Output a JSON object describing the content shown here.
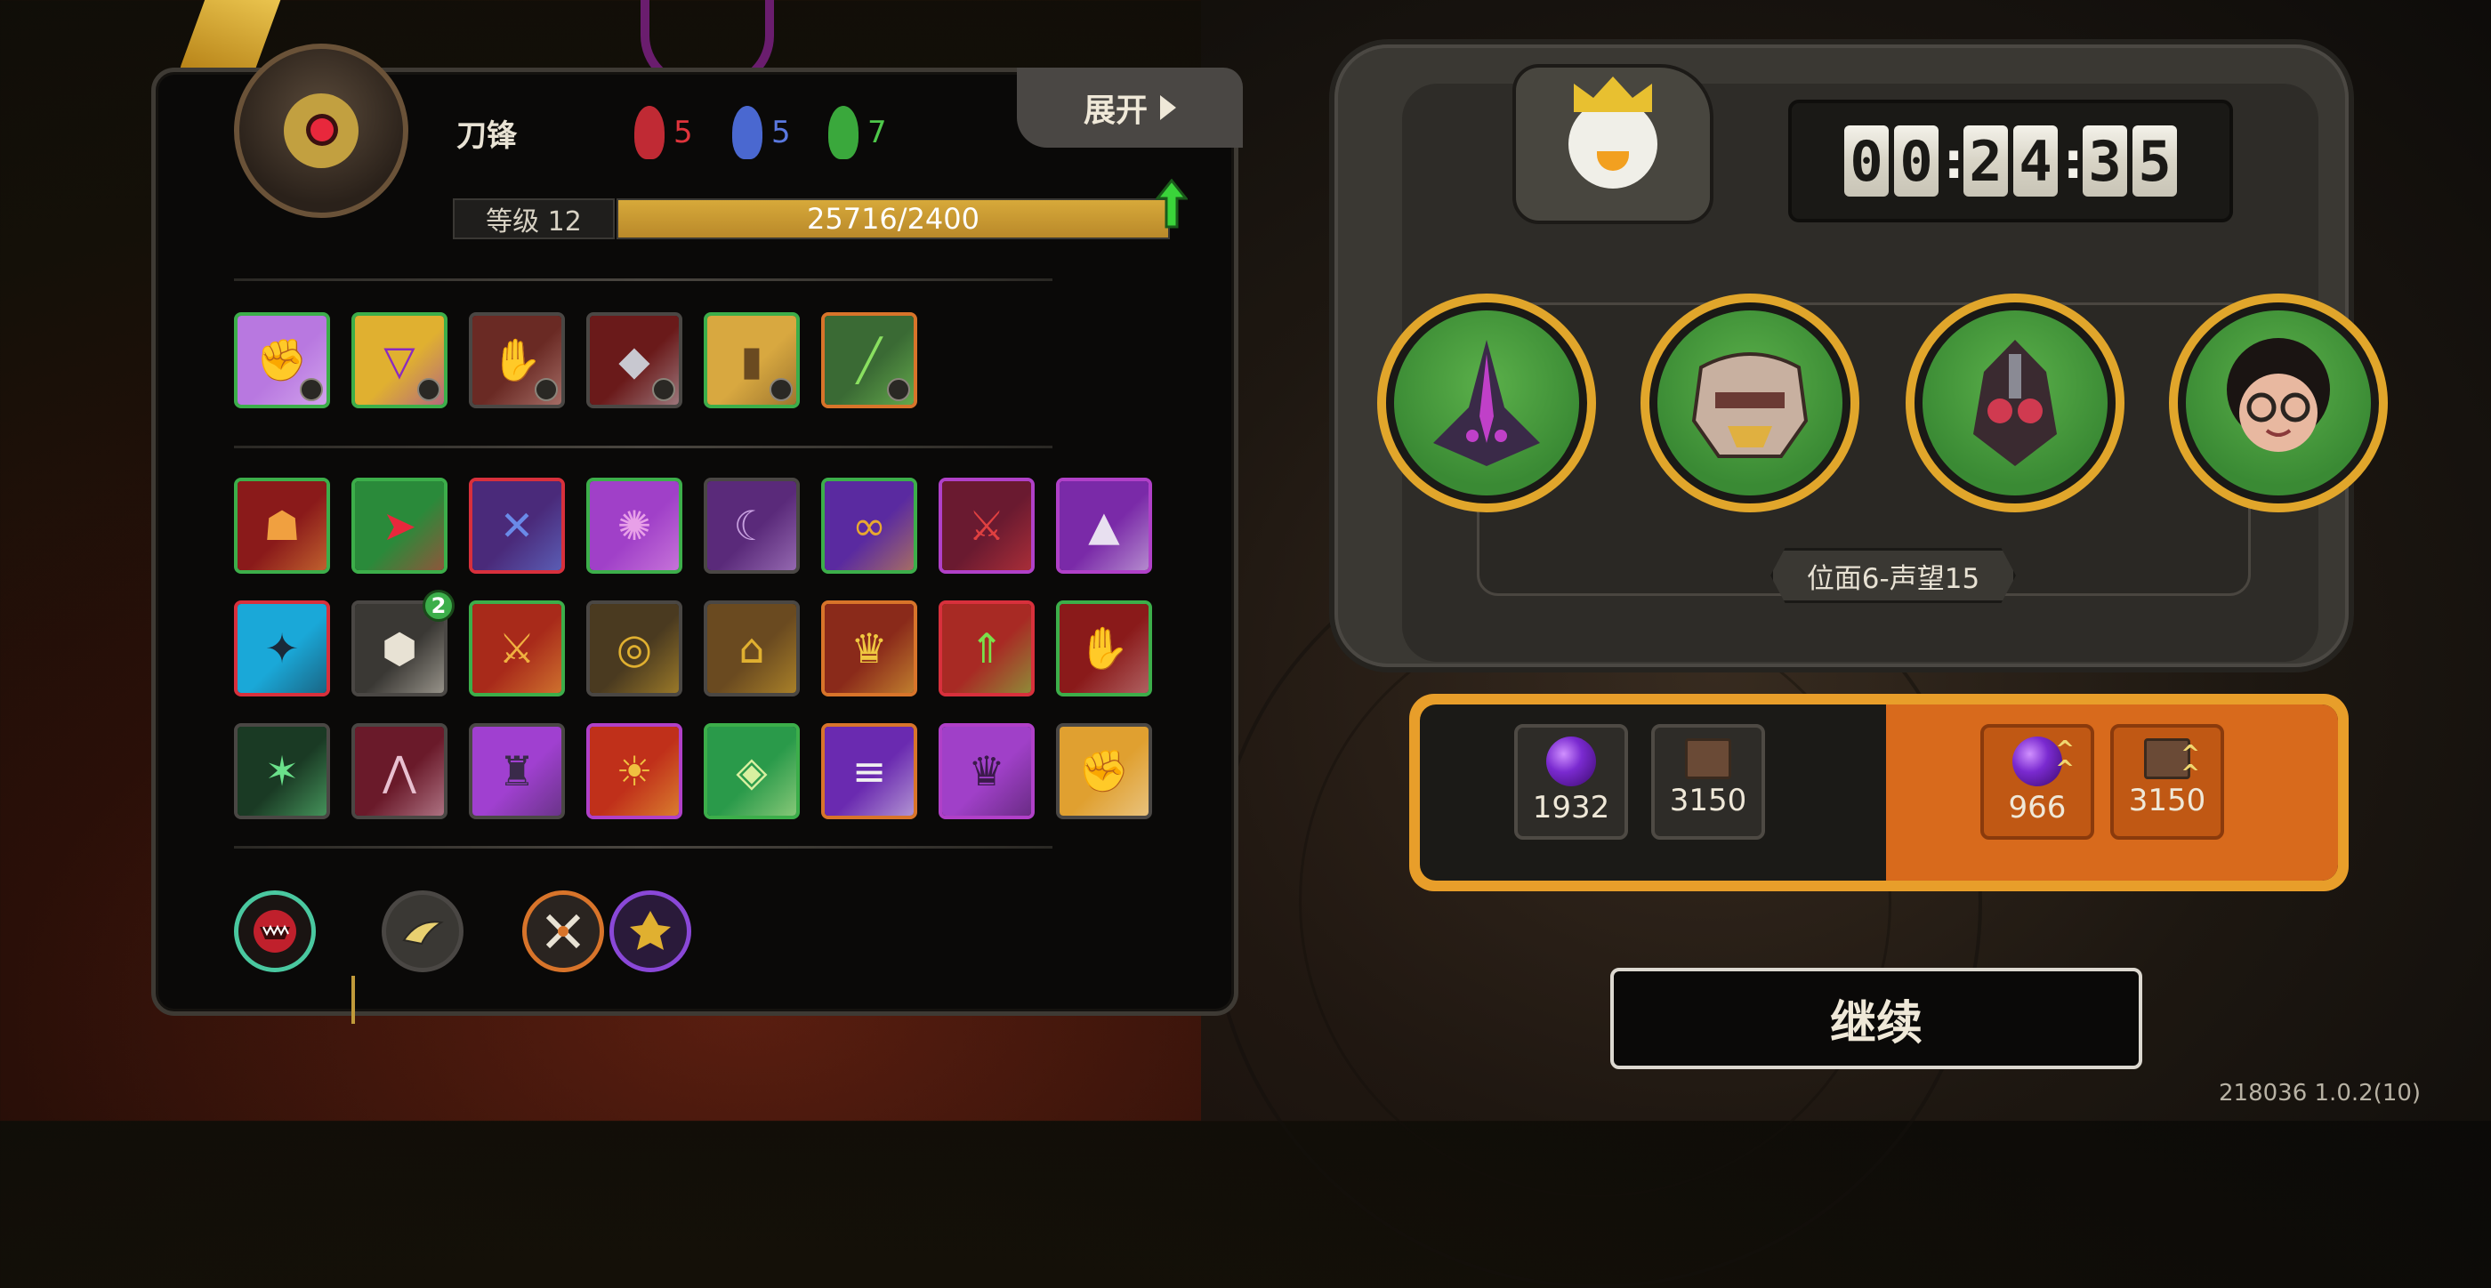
{
  "hero": {
    "name": "刀锋",
    "factions": [
      {
        "icon": "red-faction-icon",
        "count": "5",
        "color": "#e0343c"
      },
      {
        "icon": "blue-faction-icon",
        "count": "5",
        "color": "#5a78e0"
      },
      {
        "icon": "green-faction-icon",
        "count": "7",
        "color": "#4ec84a"
      }
    ],
    "level_label": "等级 12",
    "xp_text": "25716/2400",
    "xp_fill_fraction": 1.0,
    "expand_label": "展开"
  },
  "equipment_row": [
    {
      "icon": "purple-fist-icon",
      "border": "green"
    },
    {
      "icon": "gold-chest-icon",
      "border": "green"
    },
    {
      "icon": "claw-grip-icon",
      "border": "gray"
    },
    {
      "icon": "horned-helm-icon",
      "border": "gray"
    },
    {
      "icon": "gold-armor-icon",
      "border": "green"
    },
    {
      "icon": "green-syringe-icon",
      "border": "orange"
    }
  ],
  "skill_rows": [
    [
      {
        "icon": "red-beast-icon",
        "border": "green"
      },
      {
        "icon": "red-arrow-icon",
        "border": "green"
      },
      {
        "icon": "blue-mask-icon",
        "border": "red"
      },
      {
        "icon": "pink-blob-icon",
        "border": "green"
      },
      {
        "icon": "purple-claw-icon",
        "border": "gray"
      },
      {
        "icon": "purple-rune-icon",
        "border": "green"
      },
      {
        "icon": "red-blade-icon",
        "border": "purple"
      },
      {
        "icon": "purple-spike-icon",
        "border": "purple"
      }
    ],
    [
      {
        "icon": "cyan-star-icon",
        "border": "red"
      },
      {
        "icon": "hexagon-core-icon",
        "border": "gray",
        "badge": "2"
      },
      {
        "icon": "fire-sword-icon",
        "border": "green"
      },
      {
        "icon": "gold-shield-icon",
        "border": "gray"
      },
      {
        "icon": "gold-gate-icon",
        "border": "gray"
      },
      {
        "icon": "gold-crown-icon",
        "border": "orange"
      },
      {
        "icon": "green-tree-icon",
        "border": "red"
      },
      {
        "icon": "red-hand-icon",
        "border": "green"
      }
    ],
    [
      {
        "icon": "green-crystal-icon",
        "border": "gray"
      },
      {
        "icon": "red-rays-icon",
        "border": "gray"
      },
      {
        "icon": "purple-tower-icon",
        "border": "gray"
      },
      {
        "icon": "flame-ring-icon",
        "border": "purple"
      },
      {
        "icon": "green-diamond-icon",
        "border": "green"
      },
      {
        "icon": "purple-road-icon",
        "border": "orange"
      },
      {
        "icon": "purple-spikes-icon",
        "border": "purple"
      },
      {
        "icon": "gold-fist-icon",
        "border": "gray"
      }
    ]
  ],
  "bottom_icons": [
    {
      "icon": "red-fangs-icon"
    },
    {
      "icon": "gray-bird-icon"
    },
    {
      "icon": "crossed-blades-icon"
    },
    {
      "icon": "purple-gold-sigil-icon"
    }
  ],
  "timer": {
    "digits": [
      "0",
      "0",
      "2",
      "4",
      "3",
      "5"
    ]
  },
  "crown_icon": "crown-duck-icon",
  "team": [
    {
      "icon": "dark-horned-hero-icon"
    },
    {
      "icon": "robot-mask-hero-icon"
    },
    {
      "icon": "red-armored-hero-icon"
    },
    {
      "icon": "glasses-kid-hero-icon"
    }
  ],
  "rank_label": "位面6-声望15",
  "rewards": {
    "left": [
      {
        "icon": "purple-orb-icon",
        "value": "1932"
      },
      {
        "icon": "book-icon",
        "value": "3150"
      }
    ],
    "right": [
      {
        "icon": "purple-orb-upgrade-icon",
        "value": "966"
      },
      {
        "icon": "book-upgrade-icon",
        "value": "3150"
      }
    ]
  },
  "continue_label": "继续",
  "version": "218036 1.0.2(10)",
  "colors": {
    "accent_gold": "#e1a62b",
    "reward_orange": "#d86a1c",
    "xp_gold": "#d7a93a"
  }
}
